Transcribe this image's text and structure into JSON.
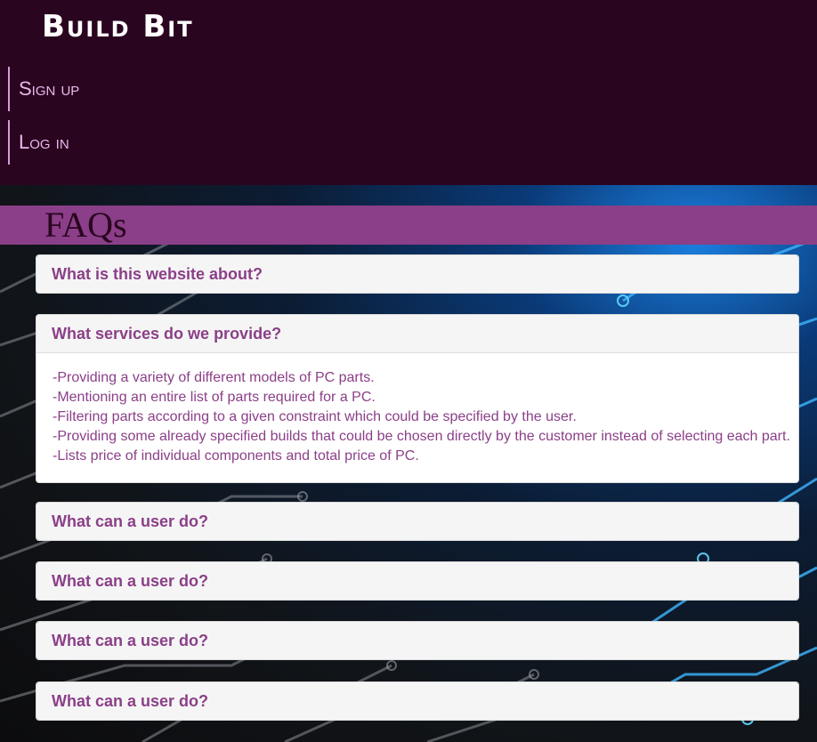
{
  "header": {
    "logo": "Build Bit",
    "nav": [
      {
        "label": "Sign up"
      },
      {
        "label": "Log in"
      }
    ]
  },
  "faq": {
    "title": "FAQs",
    "items": [
      {
        "question": "What is this website about?"
      },
      {
        "question": "What services do we provide?",
        "answer": [
          "-Providing a variety of different models of PC parts.",
          "-Mentioning an entire list of parts required for a PC.",
          "-Filtering parts according to a given constraint which could be specified by the user.",
          "-Providing some already specified builds that could be chosen directly by the customer instead of selecting each part.",
          "-Lists price of individual components and total price of PC."
        ]
      },
      {
        "question": "What can a user do?"
      },
      {
        "question": "What can a user do?"
      },
      {
        "question": "What can a user do?"
      },
      {
        "question": "What can a user do?"
      }
    ]
  },
  "colors": {
    "header_bg": "#2a0520",
    "accent": "#8b3f88",
    "nav_text": "#e9b8e8"
  }
}
